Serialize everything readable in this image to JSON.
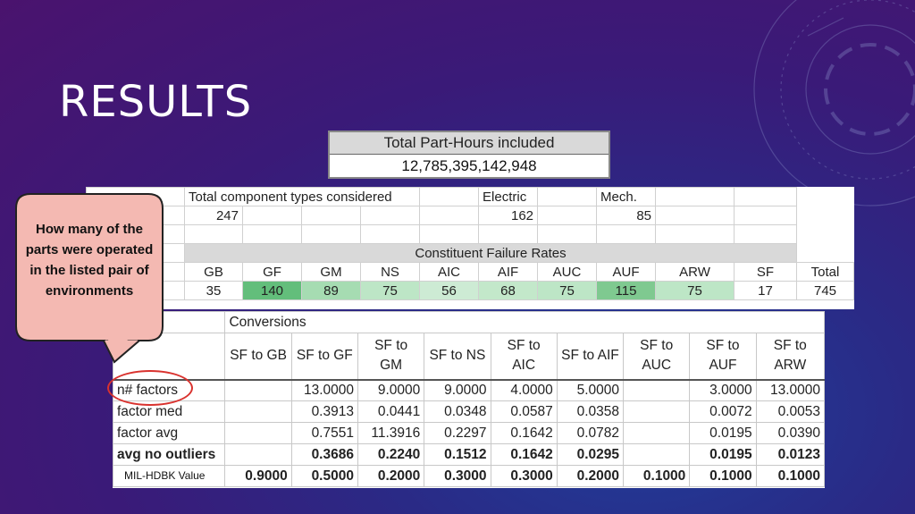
{
  "slide": {
    "title": "RESULTS",
    "colors": {
      "bg_top": "#4a136e",
      "bg_bottom": "#1f3e9a",
      "callout_fill": "#f4b9b2",
      "highlight": "#d9322e"
    }
  },
  "part_hours": {
    "header": "Total Part-Hours included",
    "value": "12,785,395,142,948"
  },
  "components": {
    "total_label": "Total component types considered",
    "total_value": "247",
    "electric_label": "Electric",
    "electric_value": "162",
    "mech_label": "Mech.",
    "mech_value": "85",
    "cfr_label": "Constituent Failure Rates",
    "rate_headers": [
      "GB",
      "GF",
      "GM",
      "NS",
      "AIC",
      "AIF",
      "AUC",
      "AUF",
      "ARW",
      "SF",
      "Total"
    ],
    "rate_values": [
      "35",
      "140",
      "89",
      "75",
      "56",
      "68",
      "75",
      "115",
      "75",
      "17",
      "745"
    ]
  },
  "conversions": {
    "title": "Conversions",
    "headers": [
      "SF to GB",
      "SF to GF",
      "SF to GM",
      "SF to NS",
      "SF to AIC",
      "SF to AIF",
      "SF to AUC",
      "SF to AUF",
      "SF to ARW"
    ],
    "rows": [
      {
        "label": "n# factors",
        "values": [
          "",
          "13.0000",
          "9.0000",
          "9.0000",
          "4.0000",
          "5.0000",
          "",
          "3.0000",
          "13.0000"
        ]
      },
      {
        "label": "factor med",
        "values": [
          "",
          "0.3913",
          "0.0441",
          "0.0348",
          "0.0587",
          "0.0358",
          "",
          "0.0072",
          "0.0053"
        ]
      },
      {
        "label": "factor avg",
        "values": [
          "",
          "0.7551",
          "11.3916",
          "0.2297",
          "0.1642",
          "0.0782",
          "",
          "0.0195",
          "0.0390"
        ]
      },
      {
        "label": "avg no outliers",
        "values": [
          "",
          "0.3686",
          "0.2240",
          "0.1512",
          "0.1642",
          "0.0295",
          "",
          "0.0195",
          "0.0123"
        ]
      },
      {
        "label": "",
        "values": [
          "0.9000",
          "0.5000",
          "0.2000",
          "0.3000",
          "0.3000",
          "0.2000",
          "0.1000",
          "0.1000",
          "0.1000"
        ]
      }
    ],
    "mil_label": "MIL-HDBK Value"
  },
  "callout": {
    "text": "How many of the parts were operated in the listed pair of environments"
  }
}
